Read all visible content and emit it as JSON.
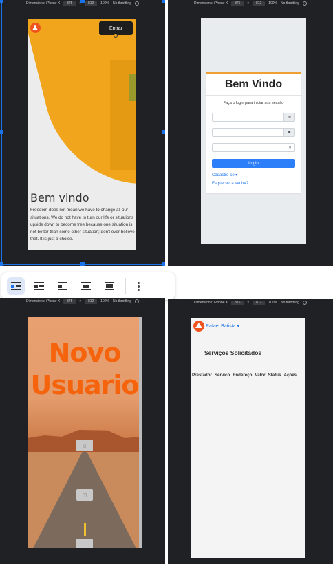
{
  "devtools": {
    "dimensions_label": "Dimensions: iPhone X",
    "width": "375",
    "times": "×",
    "height": "812",
    "zoom": "100%",
    "throttling": "No throttling"
  },
  "landing": {
    "entrar_button": "Entrar",
    "title": "Bem vindo",
    "paragraph": "Freedom does not mean we have to change all our situations. We do not have to turn our life or situations upside down to become free because one situation is not better than some other situation; don't ever believe that. It is just a choice.",
    "colors": {
      "accent": "#f1a51c",
      "logo": "#f0541e"
    }
  },
  "login": {
    "title": "Bem Vindo",
    "subtitle": "Faça o login para iniciar sua sessão",
    "email_icon": "envelope-icon",
    "password_icon": "lock-icon",
    "select_caret": "⇕",
    "login_button": "Login",
    "register_link": "Cadastre-se",
    "forgot_link": "Esqueceu a senha?",
    "colors": {
      "button": "#2d7ff9",
      "top_border": "#f0a030"
    }
  },
  "toolbar": {
    "items": [
      "align-left-wrap-icon",
      "wrap-left-icon",
      "inline-left-icon",
      "center-wrap-icon",
      "break-text-icon",
      "more-options-icon"
    ]
  },
  "new_user": {
    "title_line1": "Novo",
    "title_line2": "Usuario",
    "colors": {
      "title": "#f5640c"
    }
  },
  "services": {
    "user_name": "Rafael Batista",
    "heading": "Serviços Solicitados",
    "columns": [
      "Prestador",
      "Servico",
      "Endereço",
      "Valor",
      "Status",
      "Ações"
    ]
  }
}
